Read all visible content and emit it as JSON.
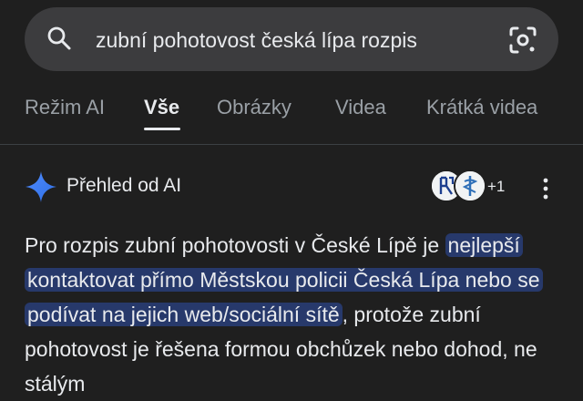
{
  "search": {
    "query": "zubní pohotovost česká lípa rozpis"
  },
  "tabs": [
    {
      "label": "Režim AI",
      "active": false
    },
    {
      "label": "Vše",
      "active": true
    },
    {
      "label": "Obrázky",
      "active": false
    },
    {
      "label": "Videa",
      "active": false
    },
    {
      "label": "Krátká videa",
      "active": false
    }
  ],
  "overview": {
    "title": "Přehled od AI",
    "source_count": "+1",
    "answer": {
      "intro": "Pro rozpis zubní pohotovosti v České Lípě je ",
      "highlight": "nejlepší kontaktovat přímo Městskou policii Česká Lípa nebo se podívat na jejich web/sociální sítě",
      "rest": ", protože zubní pohotovost je řešena formou obchůzek nebo dohod, ne stálým"
    }
  },
  "colors": {
    "background": "#1f1f1f",
    "search_bg": "#3c3c3e",
    "highlight_bg": "#27396b",
    "muted_text": "#9aa0a6"
  },
  "icons": [
    "search-icon",
    "lens-icon",
    "ai-spark-icon",
    "more-vert-icon"
  ]
}
